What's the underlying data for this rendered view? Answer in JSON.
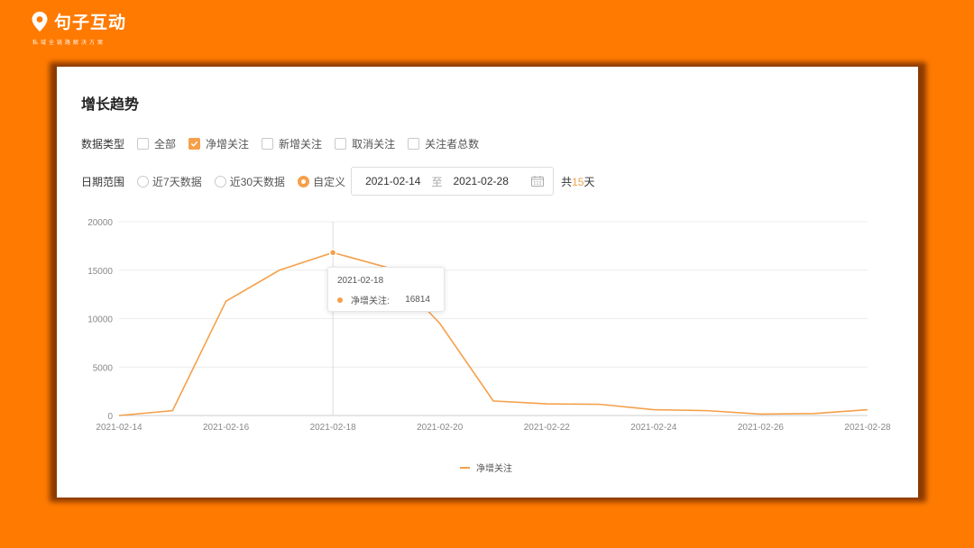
{
  "brand": {
    "name": "句子互动",
    "slogan": "私域全链路解决方案"
  },
  "panel": {
    "title": "增长趋势",
    "data_type": {
      "label": "数据类型",
      "options": [
        {
          "label": "全部",
          "checked": false
        },
        {
          "label": "净增关注",
          "checked": true
        },
        {
          "label": "新增关注",
          "checked": false
        },
        {
          "label": "取消关注",
          "checked": false
        },
        {
          "label": "关注者总数",
          "checked": false
        }
      ]
    },
    "date_range": {
      "label": "日期范围",
      "options": [
        {
          "label": "近7天数据",
          "selected": false
        },
        {
          "label": "近30天数据",
          "selected": false
        },
        {
          "label": "自定义",
          "selected": true
        }
      ],
      "start": "2021-02-14",
      "separator": "至",
      "end": "2021-02-28",
      "total_prefix": "共",
      "total_days": "15",
      "total_suffix": "天"
    }
  },
  "tooltip": {
    "date": "2021-02-18",
    "series": "净增关注:",
    "value": "16814"
  },
  "colors": {
    "accent": "#f5a04a",
    "background": "#ff7a00"
  },
  "chart_data": {
    "type": "line",
    "x": [
      "2021-02-14",
      "2021-02-15",
      "2021-02-16",
      "2021-02-17",
      "2021-02-18",
      "2021-02-19",
      "2021-02-20",
      "2021-02-21",
      "2021-02-22",
      "2021-02-23",
      "2021-02-24",
      "2021-02-25",
      "2021-02-26",
      "2021-02-27",
      "2021-02-28"
    ],
    "x_tick_labels": [
      "2021-02-14",
      "2021-02-16",
      "2021-02-18",
      "2021-02-20",
      "2021-02-22",
      "2021-02-24",
      "2021-02-26",
      "2021-02-28"
    ],
    "y_ticks": [
      0,
      5000,
      10000,
      15000,
      20000
    ],
    "ylim": [
      0,
      20000
    ],
    "series": [
      {
        "name": "净增关注",
        "values": [
          0,
          500,
          11800,
          15000,
          16814,
          15300,
          9500,
          1500,
          1200,
          1150,
          600,
          500,
          150,
          200,
          600
        ]
      }
    ],
    "highlight_index": 4,
    "grid": true,
    "legend": "bottom-center"
  }
}
